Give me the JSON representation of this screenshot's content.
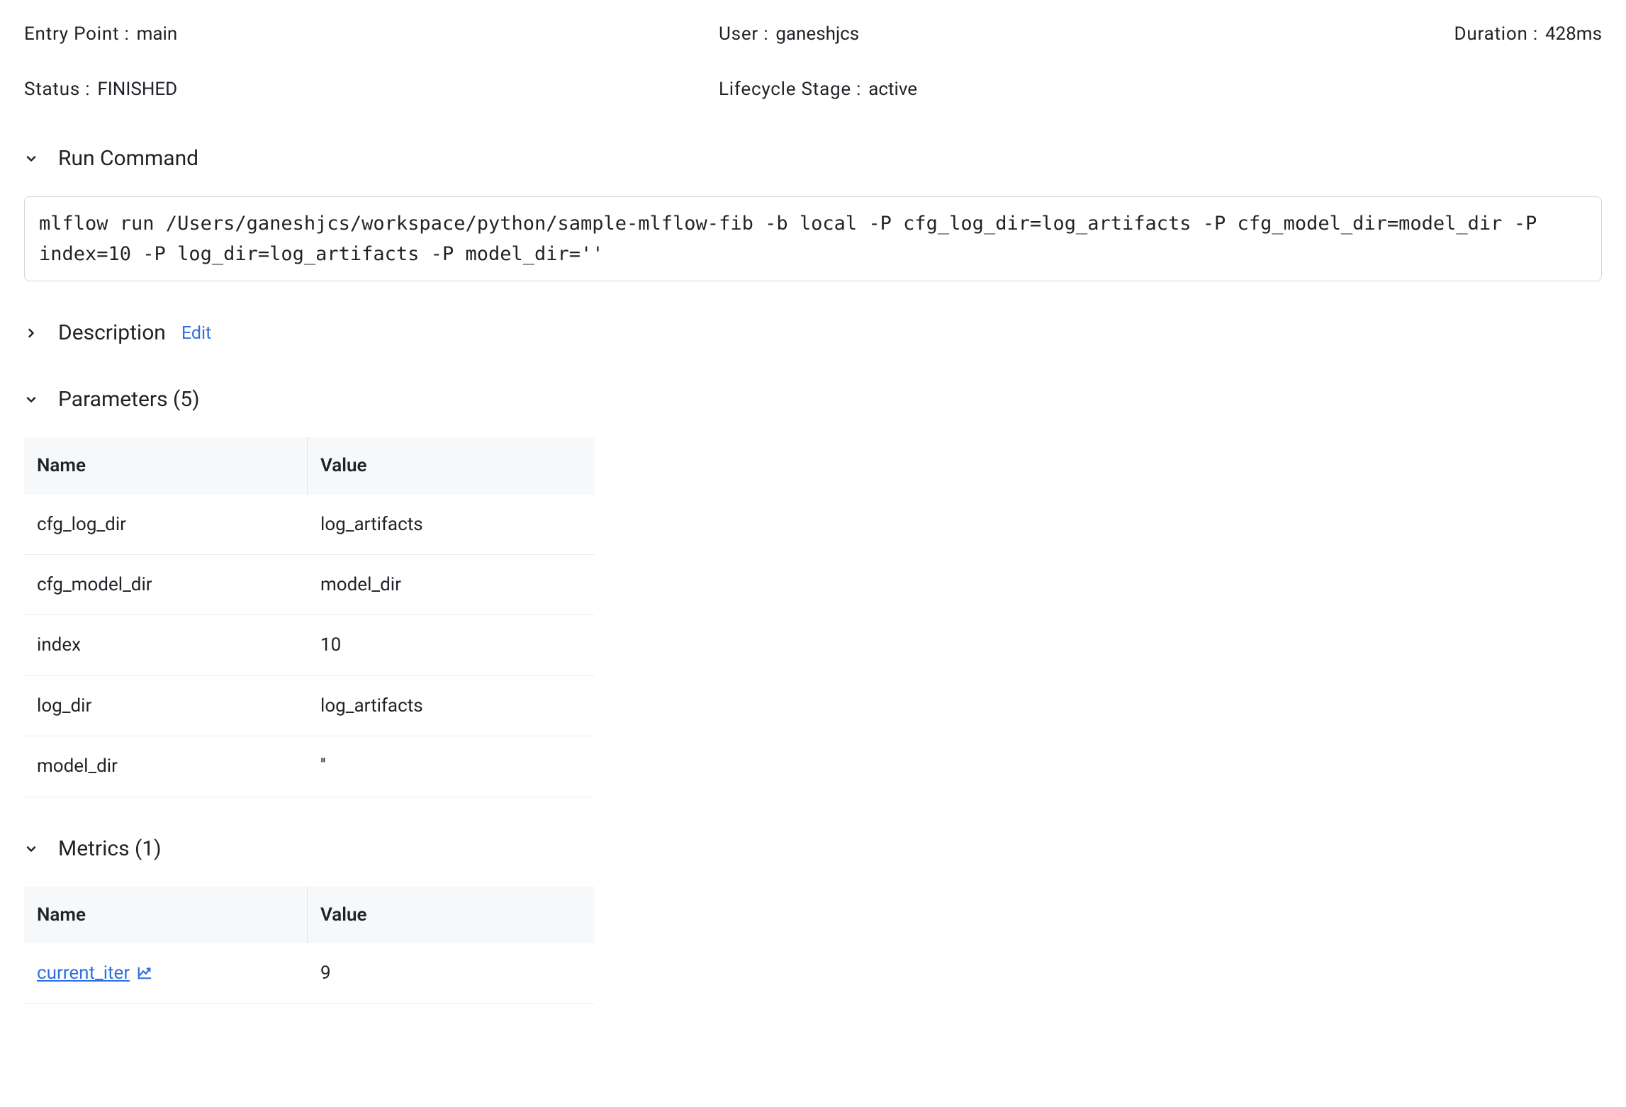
{
  "meta": {
    "entry_point_label": "Entry Point :",
    "entry_point_value": "main",
    "user_label": "User :",
    "user_value": "ganeshjcs",
    "duration_label": "Duration :",
    "duration_value": "428ms",
    "status_label": "Status :",
    "status_value": "FINISHED",
    "lifecycle_label": "Lifecycle Stage :",
    "lifecycle_value": "active"
  },
  "run_command": {
    "title": "Run Command",
    "command": "mlflow run /Users/ganeshjcs/workspace/python/sample-mlflow-fib -b local -P cfg_log_dir=log_artifacts -P cfg_model_dir=model_dir -P index=10 -P log_dir=log_artifacts -P model_dir=''"
  },
  "description": {
    "title": "Description",
    "edit_label": "Edit"
  },
  "parameters": {
    "title": "Parameters",
    "count_text": "(5)",
    "headers": {
      "name": "Name",
      "value": "Value"
    },
    "rows": [
      {
        "name": "cfg_log_dir",
        "value": "log_artifacts"
      },
      {
        "name": "cfg_model_dir",
        "value": "model_dir"
      },
      {
        "name": "index",
        "value": "10"
      },
      {
        "name": "log_dir",
        "value": "log_artifacts"
      },
      {
        "name": "model_dir",
        "value": "''"
      }
    ]
  },
  "metrics": {
    "title": "Metrics",
    "count_text": "(1)",
    "headers": {
      "name": "Name",
      "value": "Value"
    },
    "rows": [
      {
        "name": "current_iter",
        "value": "9"
      }
    ]
  }
}
